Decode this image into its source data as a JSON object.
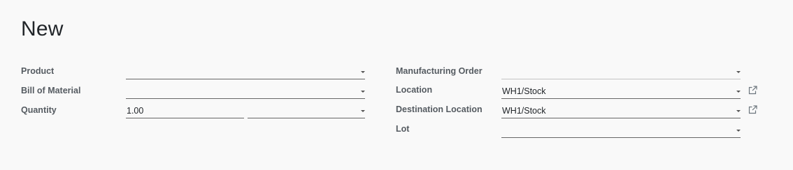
{
  "page": {
    "title": "New"
  },
  "left": {
    "product": {
      "label": "Product",
      "value": ""
    },
    "bom": {
      "label": "Bill of Material",
      "value": ""
    },
    "quantity": {
      "label": "Quantity",
      "value": "1.00",
      "uom": ""
    }
  },
  "right": {
    "manufacturing_order": {
      "label": "Manufacturing Order",
      "value": ""
    },
    "location": {
      "label": "Location",
      "value": "WH1/Stock"
    },
    "destination_location": {
      "label": "Destination Location",
      "value": "WH1/Stock"
    },
    "lot": {
      "label": "Lot",
      "value": ""
    }
  },
  "icons": {
    "dropdown": "caret-down-icon",
    "external": "external-link-icon"
  },
  "colors": {
    "background": "#f9f9f9",
    "label": "#555b61",
    "text": "#212529",
    "underline": "#666666",
    "underline_light": "#c4c4c4"
  }
}
